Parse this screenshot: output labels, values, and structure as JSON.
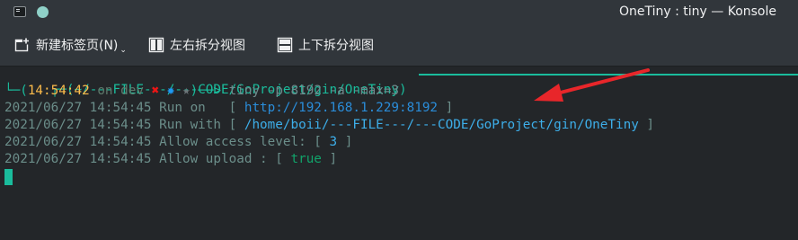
{
  "window": {
    "title": "OneTiny : tiny — Konsole"
  },
  "toolbar": {
    "new_tab_label": "新建标签页(N)",
    "split_lr_label": "左右拆分视图",
    "split_tb_label": "上下拆分视图"
  },
  "prompt": {
    "path_line": "┌─(~/---FILE---/---CODE/GoProject/gin/OneTiny)",
    "time": "14:54:42",
    "branch": "on dev",
    "x_mark": "✖",
    "star_blue": "✸",
    "star_grey": "★",
    "command": "tiny -p 8192 -a -max=3"
  },
  "log_lines": [
    {
      "prefix": "2021/06/27 14:54:45 Run on   [ ",
      "value": "http://192.168.1.229:8192",
      "suffix": " ]"
    },
    {
      "prefix": "2021/06/27 14:54:45 Run with [ ",
      "value": "/home/boii/---FILE---/---CODE/GoProject/gin/OneTiny",
      "suffix": " ]"
    },
    {
      "prefix": "2021/06/27 14:54:45 Allow access level: [ ",
      "value": "3",
      "suffix": " ]"
    },
    {
      "prefix": "2021/06/27 14:54:45 Allow upload : [ ",
      "value": "true",
      "suffix": " ]"
    }
  ],
  "colors": {
    "frame": "#1abc9c",
    "time": "#fdbc4b",
    "url": "#2a8cd8",
    "annotation_arrow": "#e8262a"
  },
  "icons": [
    "terminal-app-icon",
    "pin-icon",
    "new-tab-icon",
    "split-left-right-icon",
    "split-top-bottom-icon",
    "chevron-down-icon",
    "annotation-arrow"
  ]
}
